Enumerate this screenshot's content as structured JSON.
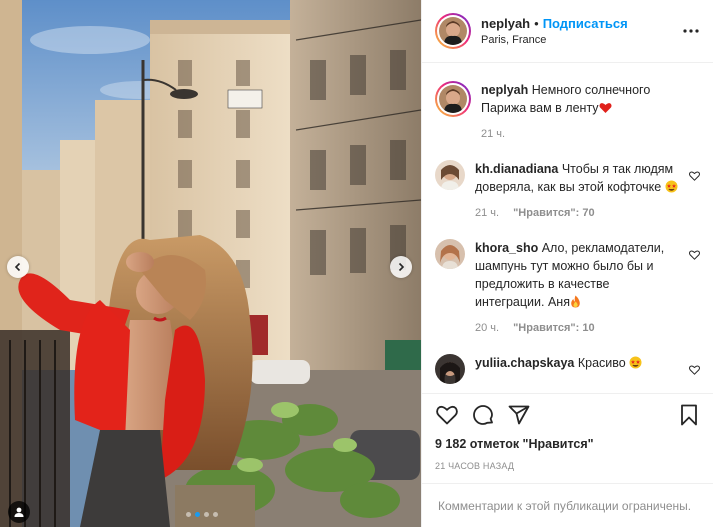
{
  "post": {
    "author": {
      "username": "neplyah",
      "follow_label": "Подписаться",
      "separator": "•",
      "location": "Paris, France"
    },
    "caption": {
      "username": "neplyah",
      "text": "Немного солнечного Парижа вам в ленту",
      "emoji": "red-heart",
      "time": "21 ч."
    },
    "comments": [
      {
        "username": "kh.dianadiana",
        "text": "Чтобы я так людям доверяла, как вы этой кофточке",
        "emoji": "star-struck",
        "time": "21 ч.",
        "likes": "\"Нравится\": 70"
      },
      {
        "username": "khora_sho",
        "text": "Ало, рекламодатели, шампунь тут можно было бы и предложить в качестве интеграции. Аня",
        "emoji": "fire",
        "time": "20 ч.",
        "likes": "\"Нравится\": 10"
      },
      {
        "username": "yuliia.chapskaya",
        "text": "Красиво",
        "emoji": "star-struck"
      }
    ],
    "likes_summary": "9 182 отметок \"Нравится\"",
    "date": "21 часов назад",
    "comments_limited": "Комментарии к этой публикации ограничены.",
    "carousel": {
      "total": 4,
      "active_index": 1
    },
    "colors": {
      "accent": "#0095f6",
      "text": "#262626",
      "muted": "#8e8e8e",
      "divider": "#efefef"
    },
    "icons": {
      "more": "more-horizontal-icon",
      "like": "heart-outline-icon",
      "comment": "comment-bubble-icon",
      "share": "paper-plane-icon",
      "save": "bookmark-icon"
    }
  }
}
